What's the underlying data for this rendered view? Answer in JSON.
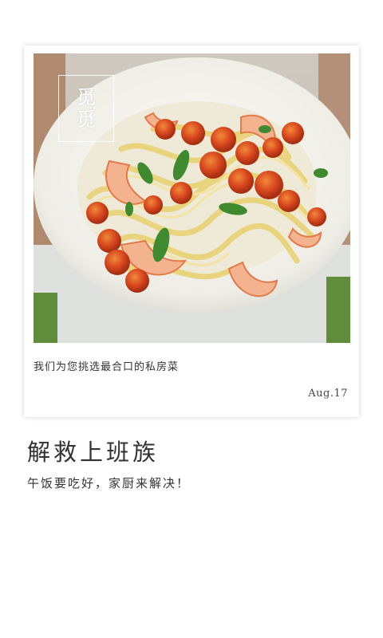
{
  "card": {
    "brand": [
      "觅",
      "觅"
    ],
    "caption": "我们为您挑选最合口的私房菜",
    "date": "Aug.17",
    "photo_icon": "pasta-shrimp-tomato-dish-photo"
  },
  "headline": "解救上班族",
  "subline": "午饭要吃好，家厨来解决！",
  "colors": {
    "background": "#ffffff",
    "text": "#333333",
    "plate": "#f1f0ea",
    "tomato": "#d8471e",
    "pasta": "#ecd98a",
    "basil": "#3f8a2f",
    "grass": "#5f8d3c"
  }
}
